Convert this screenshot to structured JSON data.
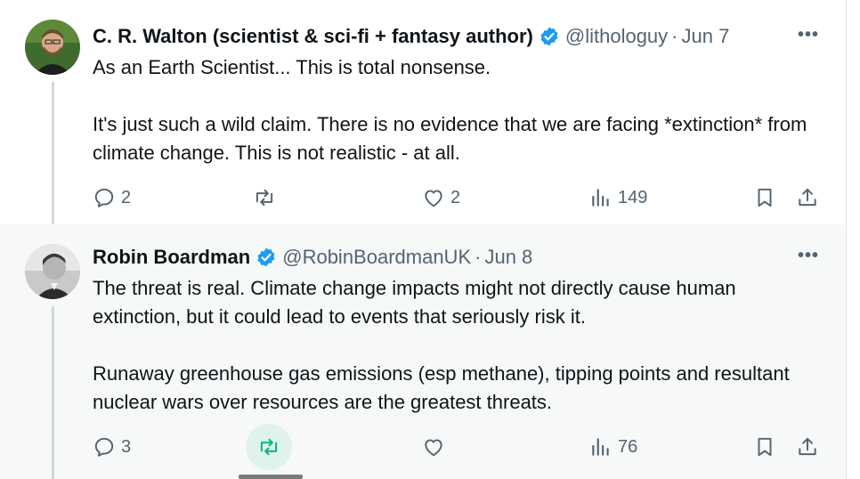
{
  "tweets": [
    {
      "author": "C. R. Walton (scientist & sci-fi + fantasy author)",
      "handle": "@lithologuy",
      "separator": "·",
      "date": "Jun 7",
      "more": "•••",
      "paragraphs": [
        "As an Earth Scientist... This is total nonsense.",
        "It's just such a wild claim. There is no evidence that we are facing *extinction* from climate change. This is not realistic - at all."
      ],
      "replies": "2",
      "retweets": "",
      "likes": "2",
      "views": "149",
      "verified_color": "#1d9bf0"
    },
    {
      "author": "Robin Boardman",
      "handle": "@RobinBoardmanUK",
      "separator": "·",
      "date": "Jun 8",
      "more": "•••",
      "paragraphs": [
        "The threat is real. Climate change impacts might not directly cause human extinction, but it could lead to events that seriously risk it.",
        "Runaway greenhouse gas emissions (esp methane), tipping points and resultant nuclear wars over resources are the greatest threats."
      ],
      "replies": "3",
      "retweets": "",
      "likes": "",
      "views": "76",
      "retweet_active_color": "#00ba7c",
      "verified_color": "#1d9bf0"
    }
  ],
  "icons": {
    "reply": "reply-icon",
    "retweet": "retweet-icon",
    "like": "heart-icon",
    "views": "views-icon",
    "bookmark": "bookmark-icon",
    "share": "share-icon",
    "verified": "verified-badge-icon"
  }
}
